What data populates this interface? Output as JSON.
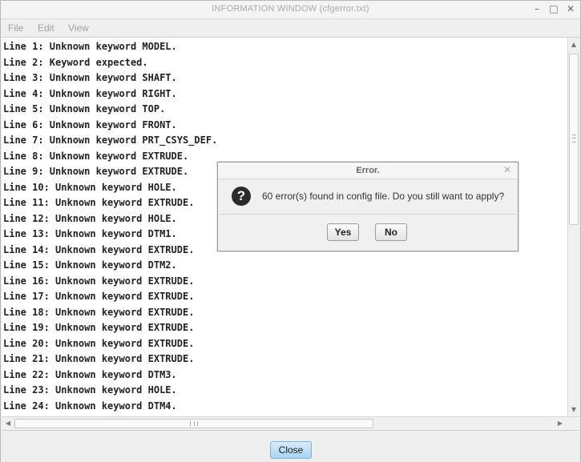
{
  "window": {
    "title": "INFORMATION  WINDOW (cfgerror.txt)",
    "controls": {
      "minimize": "–",
      "maximize": "□",
      "close": "✕"
    }
  },
  "menubar": {
    "items": [
      "File",
      "Edit",
      "View"
    ]
  },
  "content": {
    "lines": [
      "Line 1: Unknown keyword MODEL.",
      "Line 2: Keyword expected.",
      "Line 3: Unknown keyword SHAFT.",
      "Line 4: Unknown keyword RIGHT.",
      "Line 5: Unknown keyword TOP.",
      "Line 6: Unknown keyword FRONT.",
      "Line 7: Unknown keyword PRT_CSYS_DEF.",
      "Line 8: Unknown keyword EXTRUDE.",
      "Line 9: Unknown keyword EXTRUDE.",
      "Line 10: Unknown keyword HOLE.",
      "Line 11: Unknown keyword EXTRUDE.",
      "Line 12: Unknown keyword HOLE.",
      "Line 13: Unknown keyword DTM1.",
      "Line 14: Unknown keyword EXTRUDE.",
      "Line 15: Unknown keyword DTM2.",
      "Line 16: Unknown keyword EXTRUDE.",
      "Line 17: Unknown keyword EXTRUDE.",
      "Line 18: Unknown keyword EXTRUDE.",
      "Line 19: Unknown keyword EXTRUDE.",
      "Line 20: Unknown keyword EXTRUDE.",
      "Line 21: Unknown keyword EXTRUDE.",
      "Line 22: Unknown keyword DTM3.",
      "Line 23: Unknown keyword HOLE.",
      "Line 24: Unknown keyword DTM4."
    ]
  },
  "scrollbars": {
    "arrows": {
      "up": "▲",
      "down": "▼",
      "left": "◀",
      "right": "▶"
    }
  },
  "footer": {
    "close_label": "Close"
  },
  "dialog": {
    "title": "Error.",
    "close_glyph": "✕",
    "icon_glyph": "?",
    "message": "60 error(s) found in config file. Do you still want to apply?",
    "yes_label": "Yes",
    "no_label": "No"
  }
}
